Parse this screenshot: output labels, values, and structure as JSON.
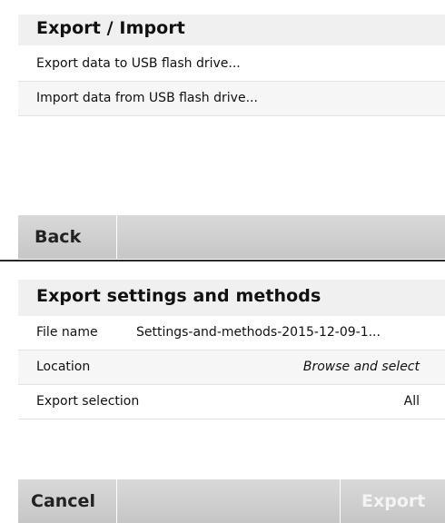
{
  "export_import": {
    "title": "Export / Import",
    "items": [
      {
        "label": "Export data to USB flash drive..."
      },
      {
        "label": "Import data from USB flash drive..."
      }
    ],
    "back_label": "Back"
  },
  "export_settings": {
    "title": "Export settings and methods",
    "rows": [
      {
        "label": "File name",
        "value": "Settings-and-methods-2015-12-09-1..."
      },
      {
        "label": "Location",
        "value": "Browse and select"
      },
      {
        "label": "Export selection",
        "value": "All"
      }
    ],
    "cancel_label": "Cancel",
    "export_label": "Export"
  }
}
